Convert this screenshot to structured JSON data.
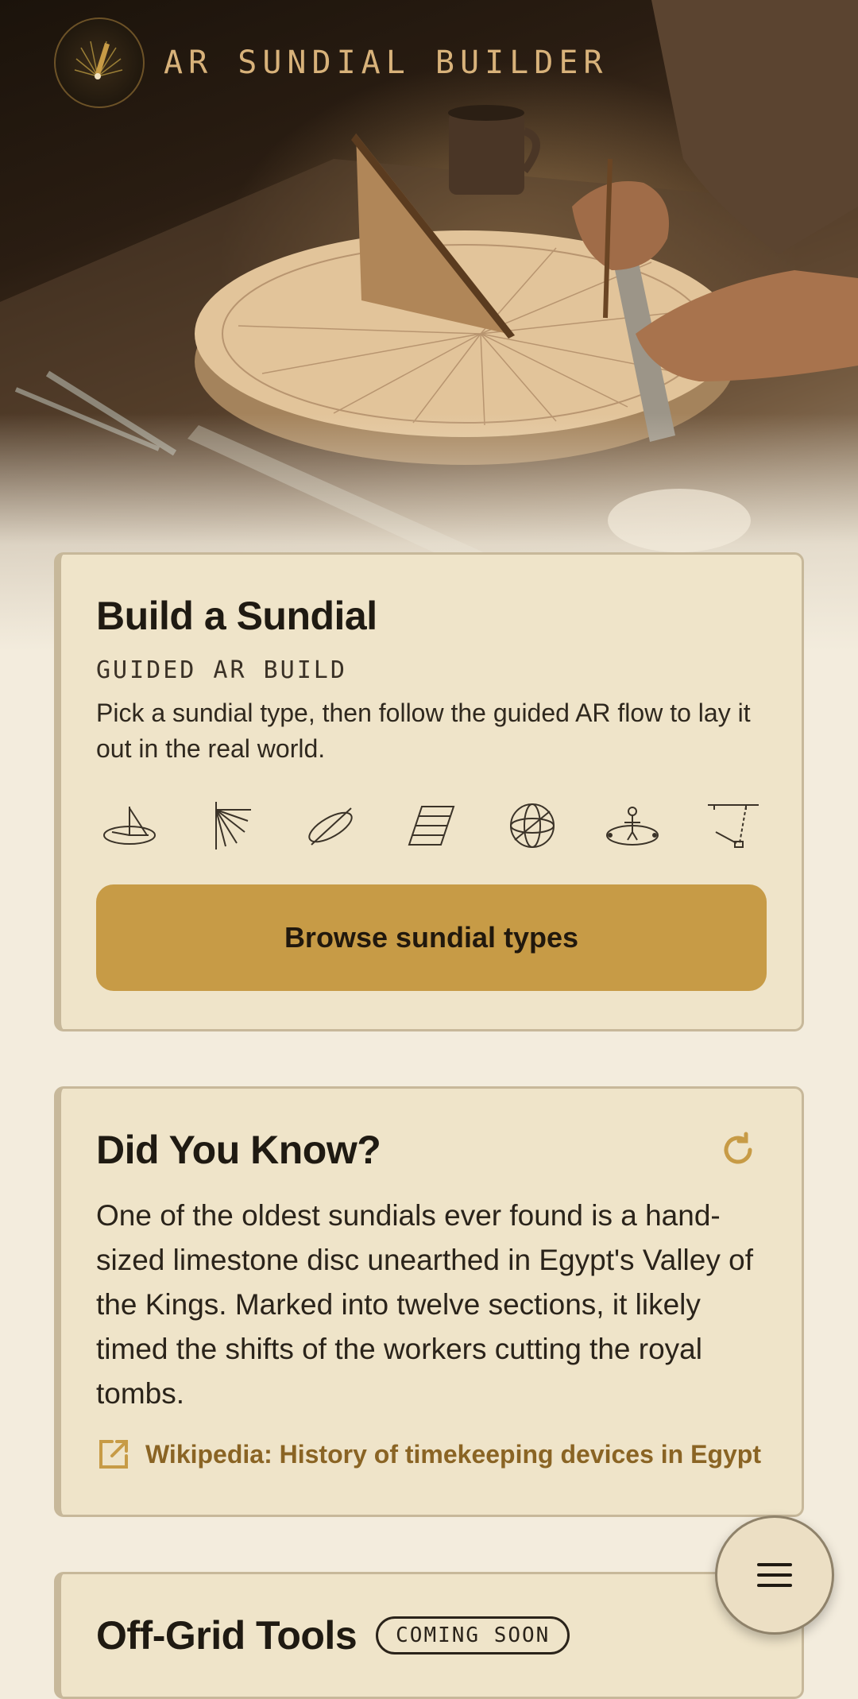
{
  "app": {
    "title": "AR SUNDIAL BUILDER"
  },
  "build_card": {
    "title": "Build a Sundial",
    "subtitle": "GUIDED AR BUILD",
    "description": "Pick a sundial type, then follow the guided AR flow to lay it out in the real world.",
    "sundial_types": [
      {
        "icon": "horizontal-sundial-icon"
      },
      {
        "icon": "vertical-sundial-icon"
      },
      {
        "icon": "equatorial-sundial-icon"
      },
      {
        "icon": "polar-sundial-icon"
      },
      {
        "icon": "armillary-sundial-icon"
      },
      {
        "icon": "analemmatic-sundial-icon"
      },
      {
        "icon": "noon-mark-sundial-icon"
      }
    ],
    "browse_label": "Browse sundial types"
  },
  "fact_card": {
    "title": "Did You Know?",
    "fact": "One of the oldest sundials ever found is a hand-sized limestone disc unearthed in Egypt's Valley of the Kings. Marked into twelve sections, it likely timed the shifts of the workers cutting the royal tombs.",
    "source_label": "Wikipedia: History of timekeeping devices in Egypt"
  },
  "tools_card": {
    "title": "Off-Grid Tools",
    "badge": "COMING SOON"
  },
  "colors": {
    "accent": "#c79b46",
    "link": "#8a6424",
    "card": "#efe4c9",
    "background": "#f3ecdd"
  }
}
